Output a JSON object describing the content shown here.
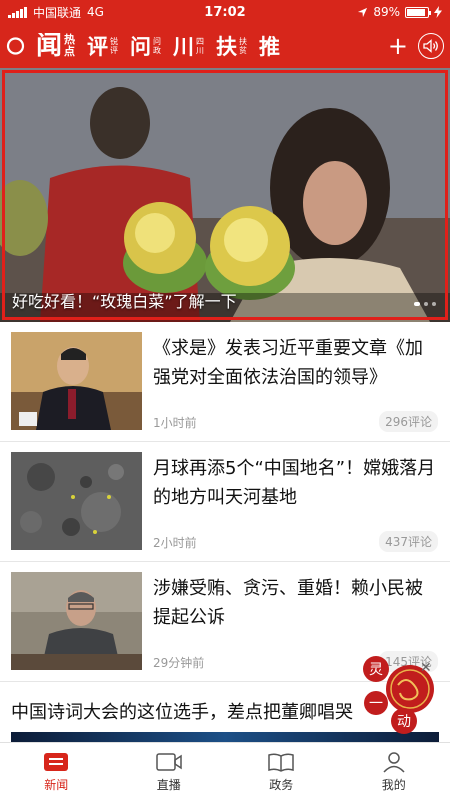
{
  "status_bar": {
    "carrier": "中国联通",
    "network": "4G",
    "time": "17:02",
    "battery": "89%",
    "battery_level": 0.89
  },
  "nav": {
    "items": [
      {
        "main": "闻",
        "sub": [
          "热",
          "点"
        ],
        "active": true
      },
      {
        "main": "评",
        "sub": [
          "锐",
          "评"
        ]
      },
      {
        "main": "问",
        "sub": [
          "问",
          "政"
        ]
      },
      {
        "main": "川",
        "sub": [
          "四",
          "川"
        ]
      },
      {
        "main": "扶",
        "sub": [
          "扶",
          "贫"
        ]
      },
      {
        "main": "推",
        "sub": []
      }
    ],
    "plus": "+"
  },
  "hero": {
    "caption": "好吃好看！“玫瑰白菜”了解一下",
    "slide_count": 3,
    "active_slide": 0
  },
  "feed": [
    {
      "title": "《求是》发表习近平重要文章《加强党对全面依法治国的领导》",
      "time": "1小时前",
      "comments": "296评论",
      "thumb": "leader-photo"
    },
    {
      "title": "月球再添5个“中国地名”！嫦娥落月的地方叫天河基地",
      "time": "2小时前",
      "comments": "437评论",
      "thumb": "moon-photo"
    },
    {
      "title": "涉嫌受贿、贪污、重婚！赖小民被提起公诉",
      "time": "29分钟前",
      "comments": "145评论",
      "thumb": "court-photo"
    }
  ],
  "text_news": {
    "title": "中国诗词大会的这位选手，差点把董卿唱哭"
  },
  "float_widget": {
    "chars": [
      "灵",
      "一",
      "动"
    ]
  },
  "tabs": [
    {
      "label": "新闻",
      "icon": "news-icon",
      "active": true
    },
    {
      "label": "直播",
      "icon": "live-icon"
    },
    {
      "label": "政务",
      "icon": "book-icon"
    },
    {
      "label": "我的",
      "icon": "profile-icon"
    }
  ],
  "colors": {
    "brand_red": "#d7261b",
    "hero_border": "#e0201a"
  }
}
